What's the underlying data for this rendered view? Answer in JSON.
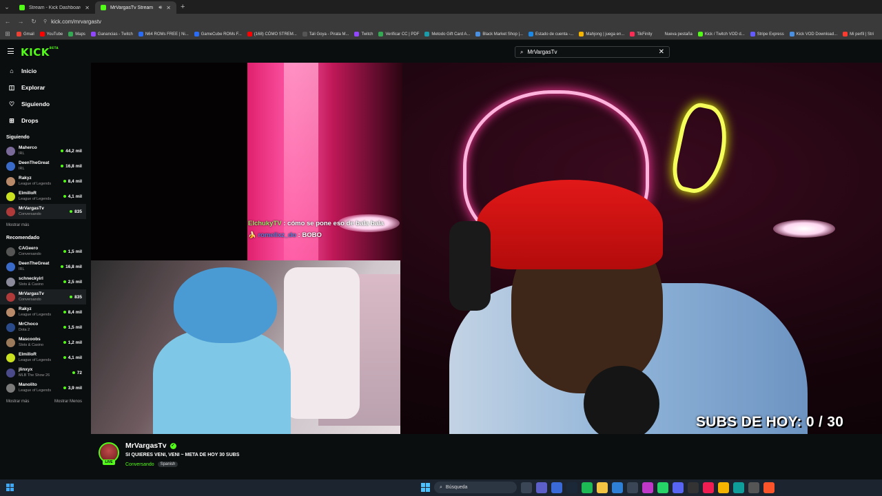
{
  "browser": {
    "tabs": [
      {
        "title": "Stream - Kick Dashboard",
        "active": false
      },
      {
        "title": "MrVargasTv Stream - Watch",
        "active": true
      }
    ],
    "url": "kick.com/mrvargastv",
    "bookmarks": [
      {
        "label": "Gmail",
        "color": "#ea4335"
      },
      {
        "label": "YouTube",
        "color": "#ff0000"
      },
      {
        "label": "Maps",
        "color": "#34a853"
      },
      {
        "label": "Ganancias - Twitch",
        "color": "#9146ff"
      },
      {
        "label": "N64 ROMs FREE | Ni...",
        "color": "#2a6df4"
      },
      {
        "label": "GameCube ROMs F...",
        "color": "#2a6df4"
      },
      {
        "label": "(168) CÓMO STREM...",
        "color": "#ff0000"
      },
      {
        "label": "Tali Goya - Pirata M...",
        "color": "#555"
      },
      {
        "label": "Twitch",
        "color": "#9146ff"
      },
      {
        "label": "Verificar CC | PDF",
        "color": "#34a853"
      },
      {
        "label": "Metodo Gift Card A...",
        "color": "#1b9aaa"
      },
      {
        "label": "Black Market Shop |...",
        "color": "#4a90e2"
      },
      {
        "label": "Estado de cuenta -...",
        "color": "#1e88e5"
      },
      {
        "label": "Mahjong | juega en...",
        "color": "#f4b400"
      },
      {
        "label": "TikFinity",
        "color": "#ff2d55"
      },
      {
        "label": "Nueva pestaña",
        "color": "#3a3a3a"
      },
      {
        "label": "Kick / Twitch VOD d...",
        "color": "#53fc18"
      },
      {
        "label": "Stripe Express",
        "color": "#635bff"
      },
      {
        "label": "Kick VOD Download...",
        "color": "#4a90e2"
      },
      {
        "label": "Mi perfil | Stri",
        "color": "#ff3b30"
      }
    ]
  },
  "kick": {
    "logo": "KICK",
    "logo_tag": "BETA",
    "search": {
      "value": "MrVargasTv"
    },
    "nav": [
      {
        "label": "Inicio",
        "icon": "home-icon",
        "glyph": "⌂"
      },
      {
        "label": "Explorar",
        "icon": "compass-icon",
        "glyph": "◫"
      },
      {
        "label": "Siguiendo",
        "icon": "heart-icon",
        "glyph": "♡"
      },
      {
        "label": "Drops",
        "icon": "gift-icon",
        "glyph": "⊞"
      }
    ],
    "following_title": "Siguiendo",
    "following": [
      {
        "name": "Maherco",
        "category": "IRL",
        "viewers": "44,2 mil",
        "color": "#7a6a9a",
        "highlight": false
      },
      {
        "name": "DeenTheGreat",
        "category": "IRL",
        "viewers": "16,8 mil",
        "color": "#3a6ac8",
        "highlight": false
      },
      {
        "name": "Rakyz",
        "category": "League of Legends",
        "viewers": "8,4 mil",
        "color": "#b88a6a",
        "highlight": false
      },
      {
        "name": "ElmilloR",
        "category": "League of Legends",
        "viewers": "4,1 mil",
        "color": "#c8e020",
        "highlight": false
      },
      {
        "name": "MrVargasTv",
        "category": "Conversando",
        "viewers": "835",
        "color": "#b03a3a",
        "highlight": true
      }
    ],
    "show_more": "Mostrar más",
    "recommended_title": "Recomendado",
    "recommended": [
      {
        "name": "CAGeero",
        "category": "Conversando",
        "viewers": "1,5 mil",
        "color": "#555",
        "highlight": false
      },
      {
        "name": "DeenTheGreat",
        "category": "IRL",
        "viewers": "16,8 mil",
        "color": "#3a6ac8",
        "highlight": false
      },
      {
        "name": "schneckyirl",
        "category": "Slots & Casino",
        "viewers": "2,5 mil",
        "color": "#8a8a9a",
        "highlight": false
      },
      {
        "name": "MrVargasTv",
        "category": "Conversando",
        "viewers": "835",
        "color": "#b03a3a",
        "highlight": true
      },
      {
        "name": "Rakyz",
        "category": "League of Legends",
        "viewers": "8,4 mil",
        "color": "#b88a6a",
        "highlight": false
      },
      {
        "name": "MrChoco",
        "category": "Dota 2",
        "viewers": "1,5 mil",
        "color": "#2a4a8a",
        "highlight": false
      },
      {
        "name": "Mascoobs",
        "category": "Slots & Casino",
        "viewers": "1,2 mil",
        "color": "#9a7a5a",
        "highlight": false
      },
      {
        "name": "ElmilloR",
        "category": "League of Legends",
        "viewers": "4,1 mil",
        "color": "#c8e020",
        "highlight": false
      },
      {
        "name": "jlinxyx",
        "category": "MLB The Show 26",
        "viewers": "72",
        "color": "#4a4a8a",
        "highlight": false
      },
      {
        "name": "Manolito",
        "category": "League of Legends",
        "viewers": "3,9 mil",
        "color": "#7a7a7a",
        "highlight": false
      }
    ],
    "show_more_2": "Mostrar más",
    "show_less": "Mostrar Menos"
  },
  "stream": {
    "chat": [
      {
        "user": "ElchukyTV",
        "message": "cómo se pone eso de bala bala"
      },
      {
        "user": "romellxz_do",
        "message": "BOBO"
      }
    ],
    "overlay_text": "SUBS DE HOY: 0 / 30",
    "channel": "MrVargasTv",
    "title": "SI QUIERES VENI, VENI ~ META DE HOY 30 SUBS",
    "category": "Conversando",
    "language": "Spanish",
    "live_badge": "LIVE"
  },
  "taskbar": {
    "search_placeholder": "Búsqueda",
    "apps": [
      {
        "icon": "task-view-icon",
        "color": "#3a4656"
      },
      {
        "icon": "chat-icon",
        "color": "#5b5fc7"
      },
      {
        "icon": "app-icon",
        "color": "#3a6ad8"
      },
      {
        "icon": "steam-icon",
        "color": "#1b2838"
      },
      {
        "icon": "spotify-icon",
        "color": "#1db954"
      },
      {
        "icon": "folder-icon",
        "color": "#f4c542"
      },
      {
        "icon": "store-icon",
        "color": "#2e7fd6"
      },
      {
        "icon": "calendar-icon",
        "color": "#3a4656"
      },
      {
        "icon": "adobe-icon",
        "color": "#c038c8"
      },
      {
        "icon": "whatsapp-icon",
        "color": "#25d366"
      },
      {
        "icon": "discord-icon",
        "color": "#5865f2"
      },
      {
        "icon": "obs-icon",
        "color": "#333"
      },
      {
        "icon": "tiktok-icon",
        "color": "#ee1d52"
      },
      {
        "icon": "chrome-icon",
        "color": "#f4b400"
      },
      {
        "icon": "edge-icon",
        "color": "#0f9d9a"
      },
      {
        "icon": "settings-icon",
        "color": "#555"
      },
      {
        "icon": "brave-icon",
        "color": "#fb542b"
      }
    ]
  }
}
